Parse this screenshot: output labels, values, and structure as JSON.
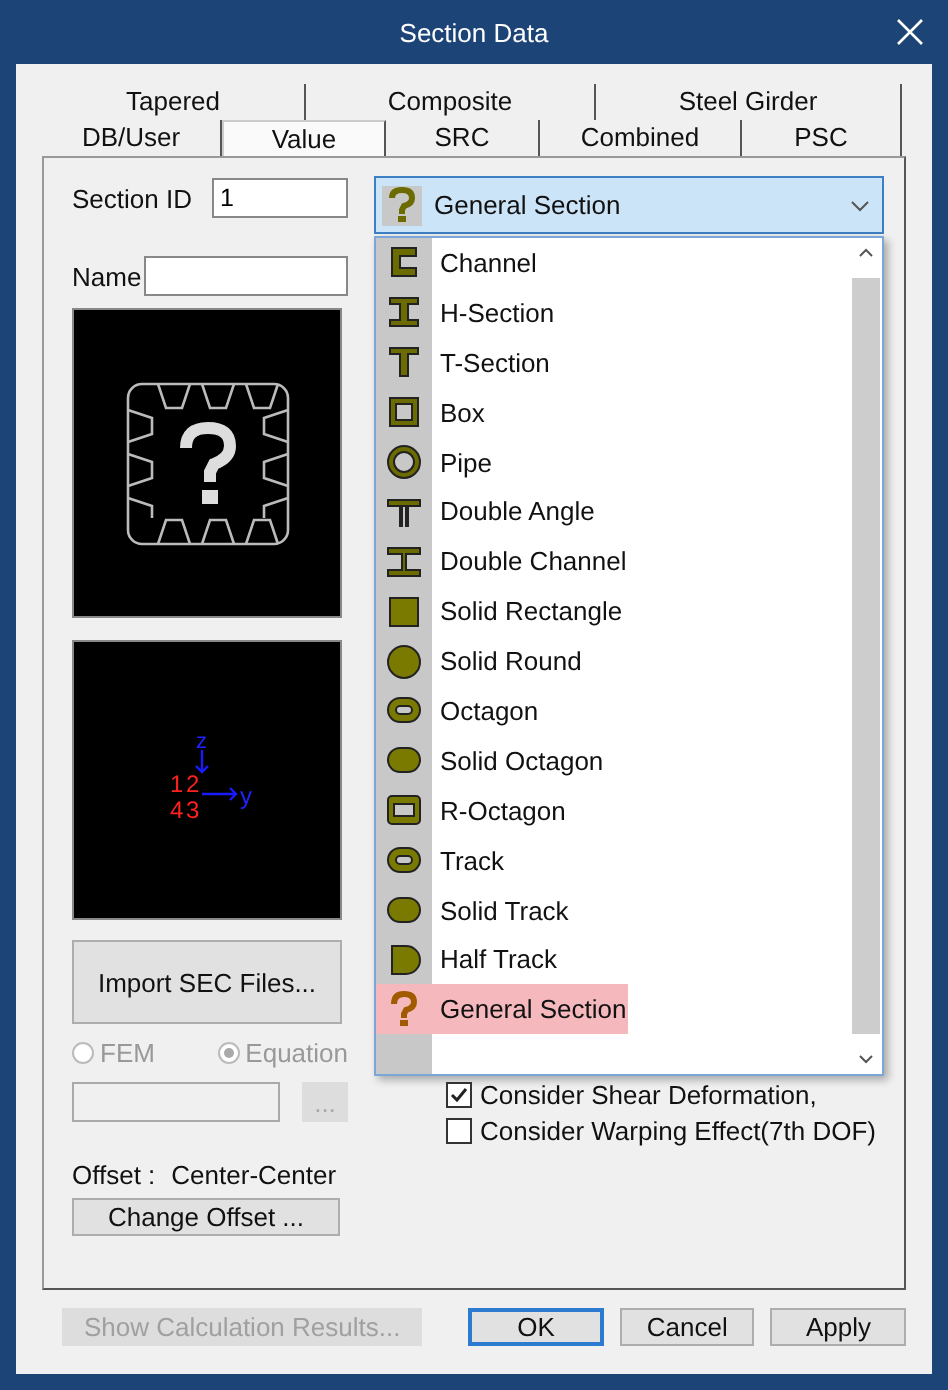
{
  "window": {
    "title": "Section Data"
  },
  "tab_rows": [
    [
      {
        "label": "Tapered",
        "selected": false
      },
      {
        "label": "Composite",
        "selected": false
      },
      {
        "label": "Steel Girder",
        "selected": false
      }
    ],
    [
      {
        "label": "DB/User",
        "selected": false
      },
      {
        "label": "Value",
        "selected": true
      },
      {
        "label": "SRC",
        "selected": false
      },
      {
        "label": "Combined",
        "selected": false
      },
      {
        "label": "PSC",
        "selected": false
      }
    ]
  ],
  "section_id": {
    "label": "Section ID",
    "value": "1"
  },
  "name": {
    "label": "Name"
  },
  "axes": {
    "z": "z",
    "y": "y",
    "points": [
      "1",
      "2",
      "4",
      "3"
    ]
  },
  "import_button": "Import SEC Files...",
  "method_options": [
    {
      "label": "FEM",
      "selected": false,
      "disabled": true
    },
    {
      "label": "Equation",
      "selected": true,
      "disabled": true
    }
  ],
  "browse_button": "...",
  "offset": {
    "label": "Offset :",
    "value": "Center-Center"
  },
  "change_offset_button": "Change Offset ...",
  "section_type": {
    "value": "General Section",
    "expanded": true,
    "items": [
      {
        "label": "Channel",
        "kind": "channel",
        "selected": false
      },
      {
        "label": "H-Section",
        "kind": "h-section",
        "selected": false
      },
      {
        "label": "T-Section",
        "kind": "t-section",
        "selected": false
      },
      {
        "label": "Box",
        "kind": "box",
        "selected": false
      },
      {
        "label": "Pipe",
        "kind": "pipe",
        "selected": false
      },
      {
        "label": "Double Angle",
        "kind": "double-angle",
        "selected": false
      },
      {
        "label": "Double Channel",
        "kind": "double-channel",
        "selected": false
      },
      {
        "label": "Solid Rectangle",
        "kind": "solid-rectangle",
        "selected": false
      },
      {
        "label": "Solid Round",
        "kind": "solid-round",
        "selected": false
      },
      {
        "label": "Octagon",
        "kind": "octagon",
        "selected": false
      },
      {
        "label": "Solid Octagon",
        "kind": "solid-octagon",
        "selected": false
      },
      {
        "label": "R-Octagon",
        "kind": "r-octagon",
        "selected": false
      },
      {
        "label": "Track",
        "kind": "track",
        "selected": false
      },
      {
        "label": "Solid Track",
        "kind": "solid-track",
        "selected": false
      },
      {
        "label": "Half Track",
        "kind": "half-track",
        "selected": false
      },
      {
        "label": "General Section",
        "kind": "general",
        "selected": true
      }
    ]
  },
  "options": [
    {
      "label": "Consider Shear Deformation,",
      "checked": true
    },
    {
      "label": "Consider Warping Effect(7th DOF)",
      "checked": false
    }
  ],
  "footer_buttons": [
    {
      "label": "Show Calculation Results...",
      "disabled": true,
      "default": false
    },
    {
      "label": "OK",
      "disabled": false,
      "default": true
    },
    {
      "label": "Cancel",
      "disabled": false,
      "default": false
    },
    {
      "label": "Apply",
      "disabled": false,
      "default": false
    }
  ]
}
